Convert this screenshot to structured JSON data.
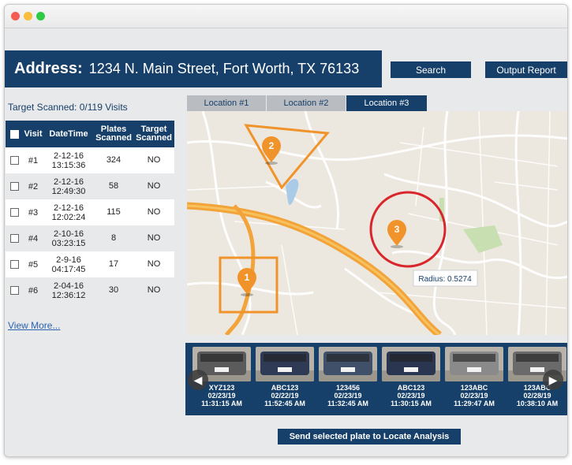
{
  "address": {
    "label": "Address:",
    "value": "1234 N. Main Street, Fort Worth, TX 76133"
  },
  "toolbar": {
    "search_label": "Search",
    "output_label": "Output Report"
  },
  "summary": {
    "target_scanned": "Target Scanned: 0/119 Visits"
  },
  "table": {
    "headers": {
      "visit": "Visit",
      "datetime": "DateTime",
      "plates": "Plates Scanned",
      "target": "Target Scanned"
    },
    "rows": [
      {
        "visit": "#1",
        "date": "2-12-16",
        "time": "13:15:36",
        "plates": "324",
        "target": "NO"
      },
      {
        "visit": "#2",
        "date": "2-12-16",
        "time": "12:49:30",
        "plates": "58",
        "target": "NO"
      },
      {
        "visit": "#3",
        "date": "2-12-16",
        "time": "12:02:24",
        "plates": "115",
        "target": "NO"
      },
      {
        "visit": "#4",
        "date": "2-10-16",
        "time": "03:23:15",
        "plates": "8",
        "target": "NO"
      },
      {
        "visit": "#5",
        "date": "2-9-16",
        "time": "04:17:45",
        "plates": "17",
        "target": "NO"
      },
      {
        "visit": "#6",
        "date": "2-04-16",
        "time": "12:36:12",
        "plates": "30",
        "target": "NO"
      }
    ],
    "view_more": "View More..."
  },
  "tabs": [
    {
      "label": "Location #1",
      "active": false
    },
    {
      "label": "Location #2",
      "active": false
    },
    {
      "label": "Location #3",
      "active": true
    }
  ],
  "map": {
    "markers": [
      "1",
      "2",
      "3"
    ],
    "radius_label": "Radius: 0.5274",
    "accent_orange": "#f0932b",
    "circle_red": "#d9262c"
  },
  "plates": [
    {
      "plate": "XYZ123",
      "date": "02/23/19",
      "time": "11:31:15 AM"
    },
    {
      "plate": "ABC123",
      "date": "02/22/19",
      "time": "11:52:45 AM"
    },
    {
      "plate": "123456",
      "date": "02/23/19",
      "time": "11:32:45 AM"
    },
    {
      "plate": "ABC123",
      "date": "02/23/19",
      "time": "11:30:15 AM"
    },
    {
      "plate": "123ABC",
      "date": "02/23/19",
      "time": "11:29:47 AM"
    },
    {
      "plate": "123ABC",
      "date": "02/28/19",
      "time": "10:38:10 AM"
    }
  ],
  "actions": {
    "send_label": "Send selected plate to Locate Analysis"
  },
  "colors": {
    "navy": "#163f69",
    "link": "#2b62b0"
  }
}
